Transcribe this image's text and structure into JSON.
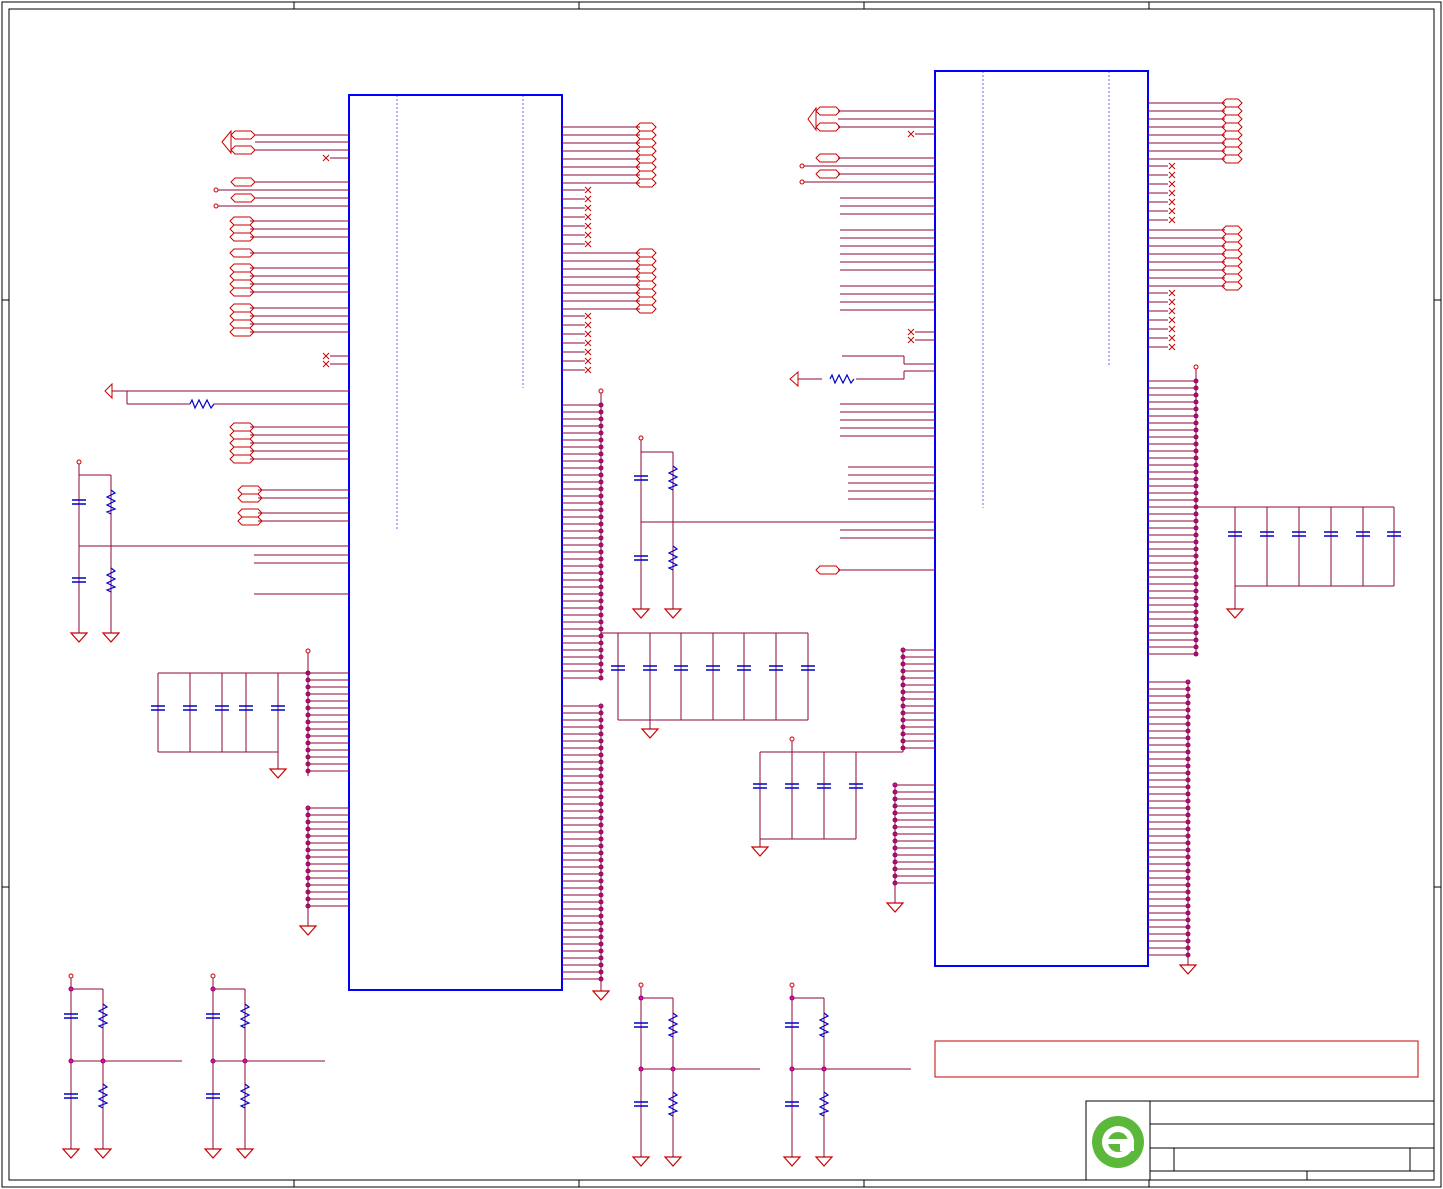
{
  "title_block": {
    "logo": "green-e-logo",
    "title": "",
    "document_number": "",
    "size": "",
    "revision": "",
    "sheet": ""
  },
  "colors": {
    "border": "#000000",
    "chip_outline": "#0000ff",
    "net": "#8b0a3a",
    "port": "#cc0000",
    "component": "#0000cc",
    "junction": "#e600e6",
    "note_box": "#cc0000",
    "logo": "#5cb83a"
  },
  "components": {
    "chips": [
      "u-left-soc",
      "u-right-soc"
    ],
    "note_box": ""
  }
}
